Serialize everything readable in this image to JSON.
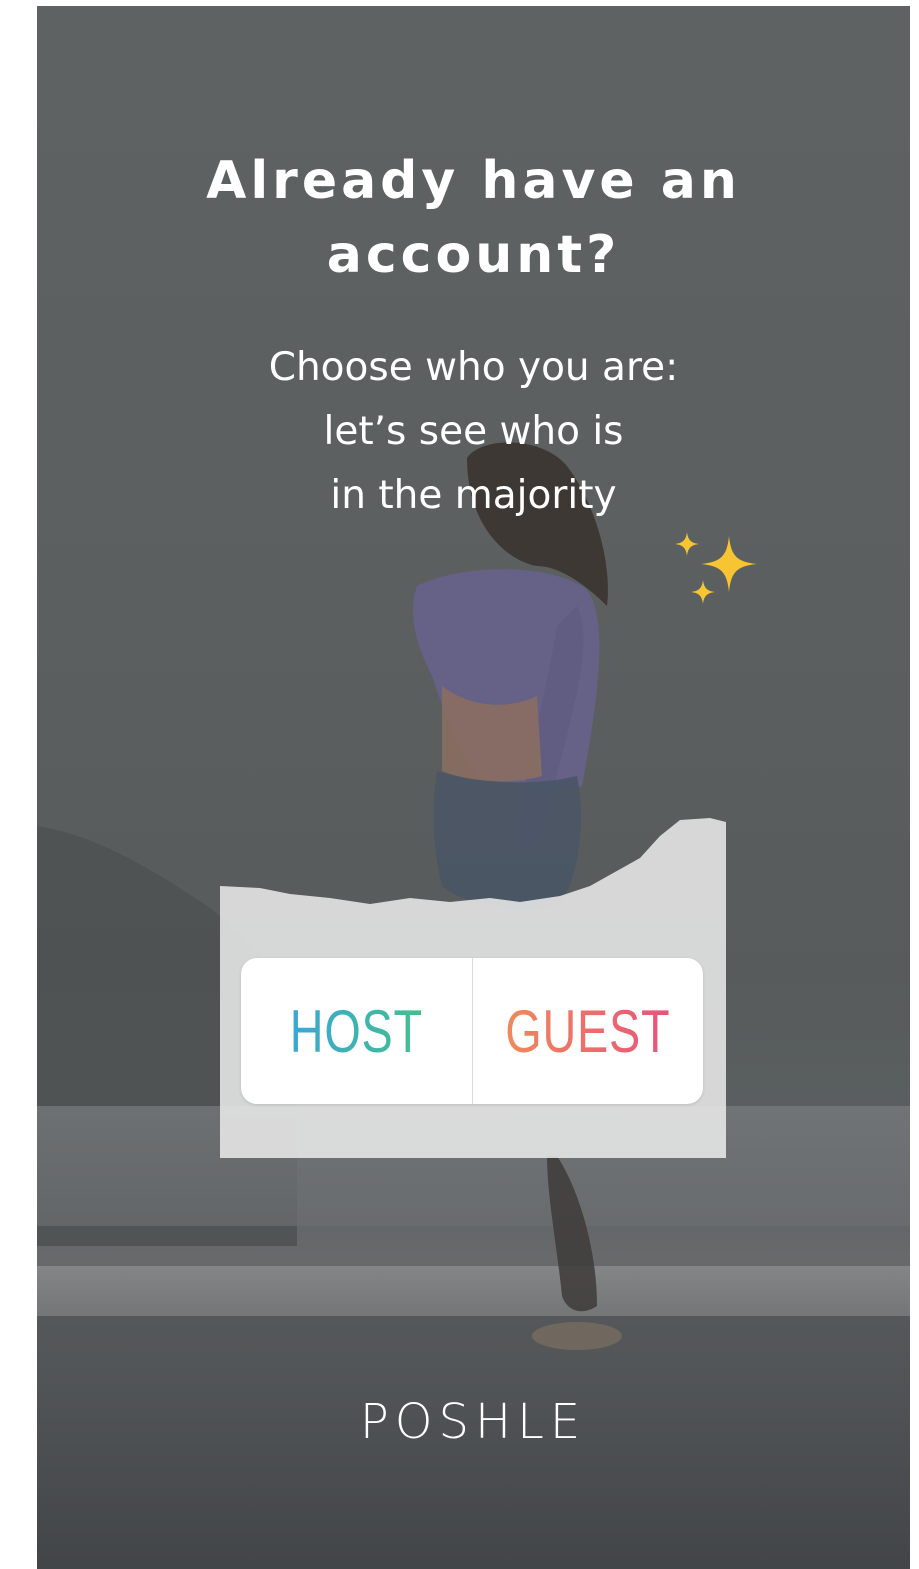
{
  "story": {
    "title_line1": "Already have an",
    "title_line2": "account?",
    "subtitle_line1": "Choose who you are:",
    "subtitle_line2": "let’s see who is",
    "subtitle_line3": "in the majority",
    "sparkle_icon": "sparkles-icon"
  },
  "poll": {
    "option_host": "HOST",
    "option_guest": "GUEST",
    "host_gradient": [
      "#3aa6d6",
      "#43c08c"
    ],
    "guest_gradient": [
      "#f0895a",
      "#e8537d"
    ]
  },
  "brand": {
    "logo_text": "POSHLE"
  }
}
